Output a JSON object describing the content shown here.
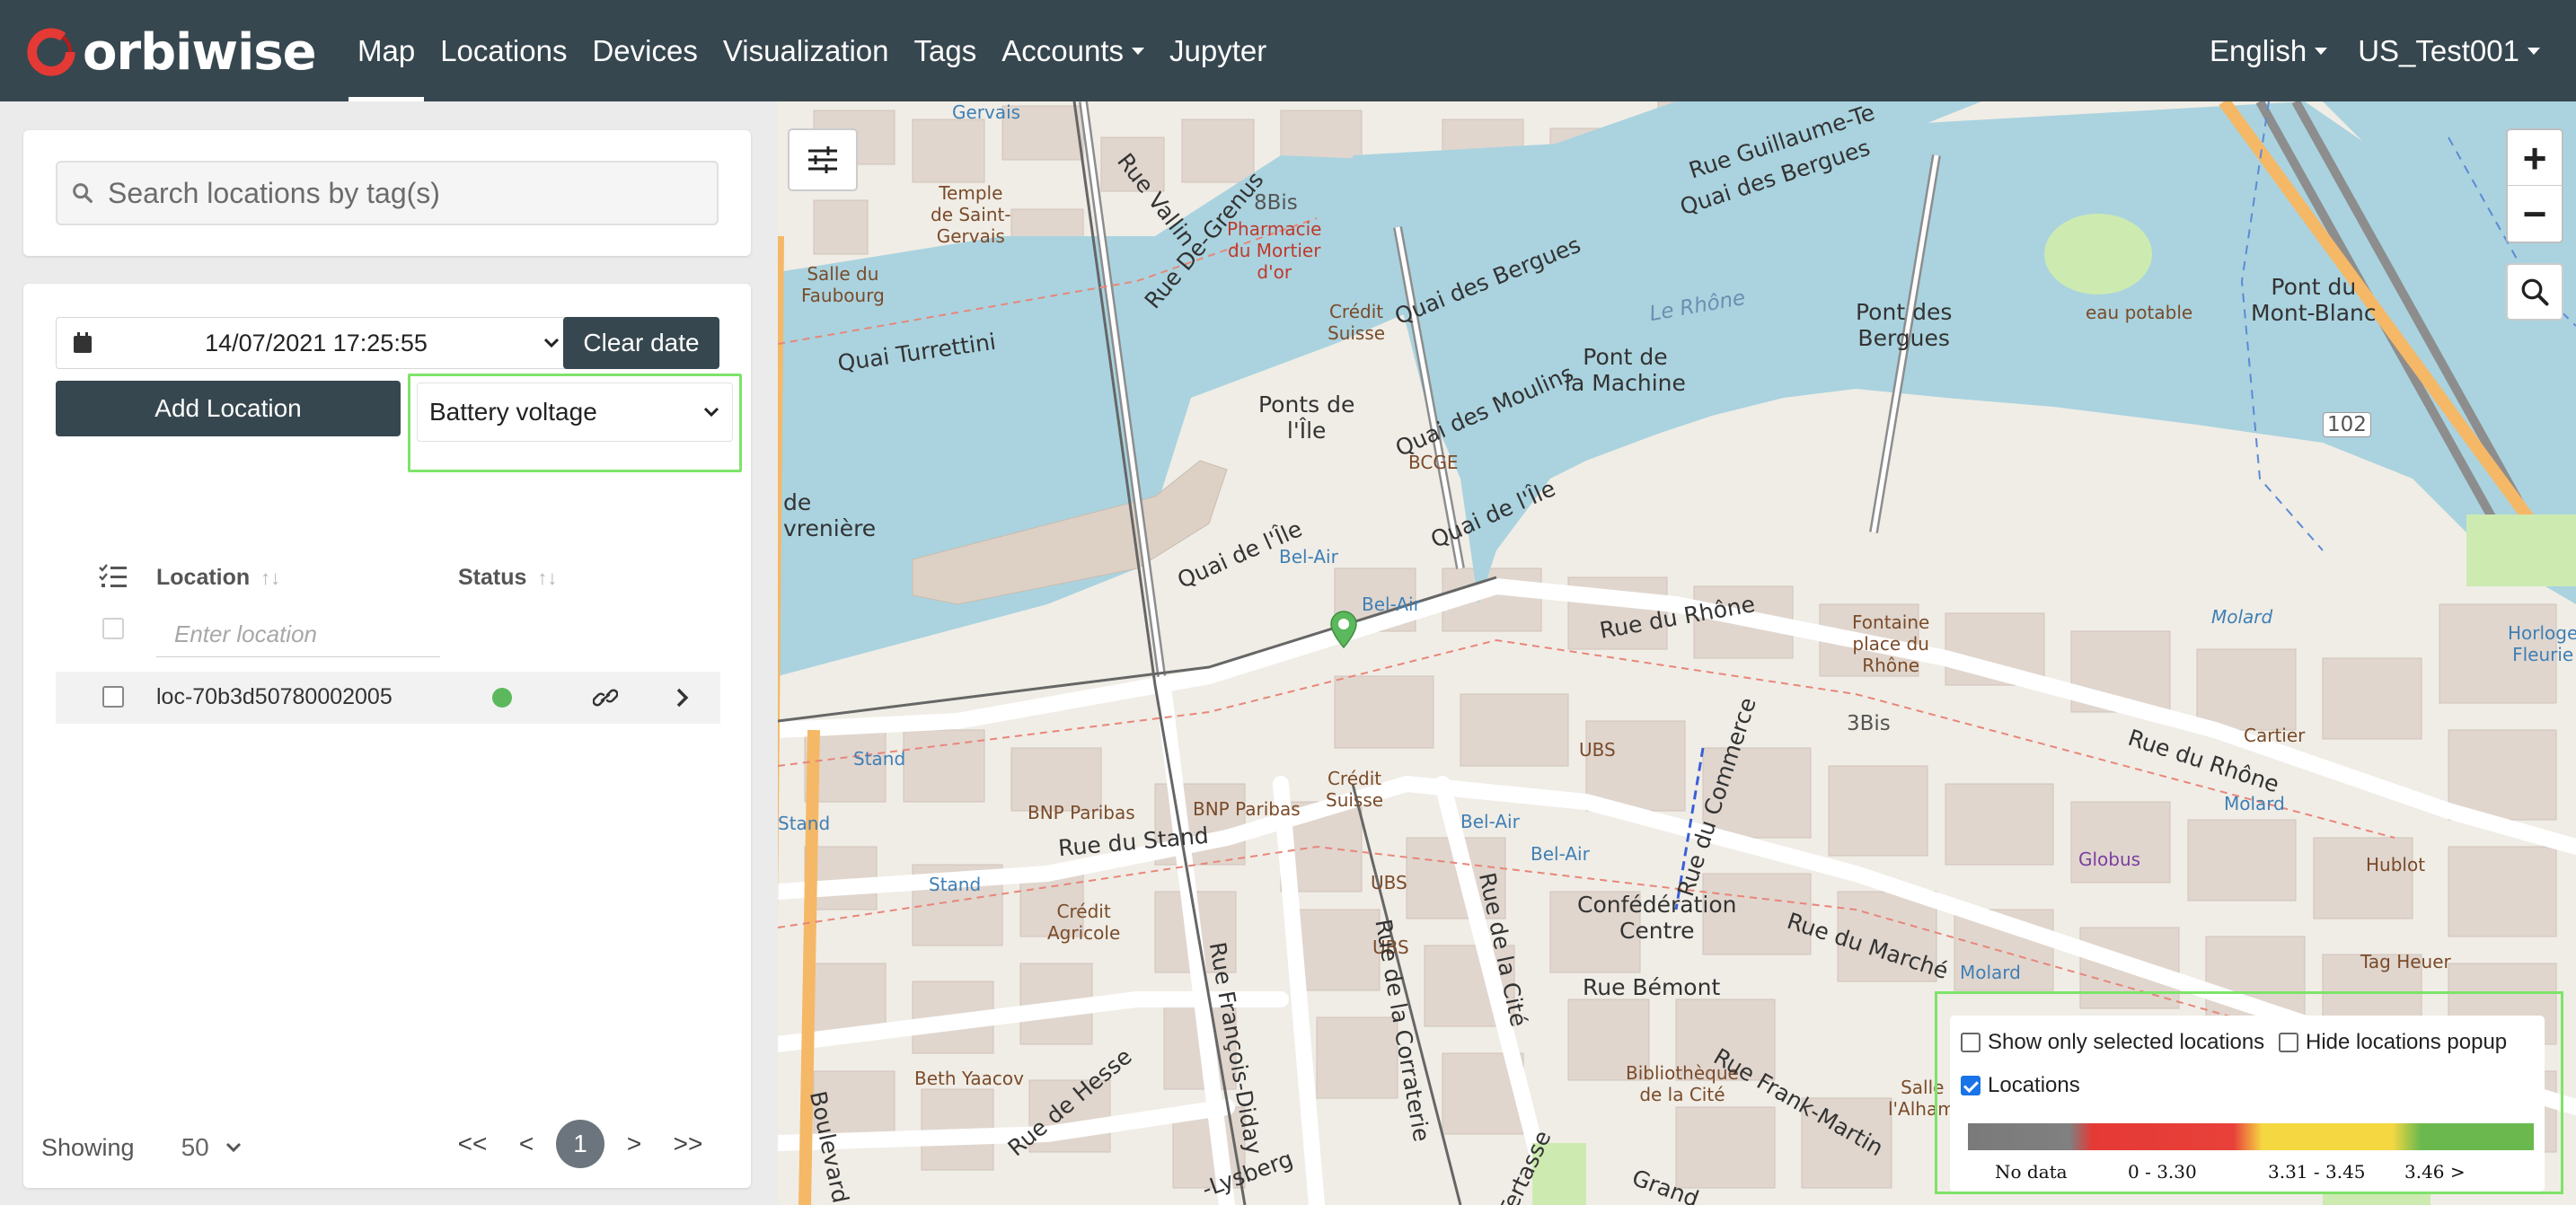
{
  "app": {
    "brand": "orbiwise"
  },
  "nav": {
    "items": [
      {
        "label": "Map",
        "active": true
      },
      {
        "label": "Locations"
      },
      {
        "label": "Devices"
      },
      {
        "label": "Visualization"
      },
      {
        "label": "Tags"
      },
      {
        "label": "Accounts"
      },
      {
        "label": "Jupyter"
      }
    ],
    "language": "English",
    "user": "US_Test001"
  },
  "sidebar": {
    "search": {
      "placeholder": "Search locations by tag(s)"
    },
    "date": {
      "value": "14/07/2021 17:25:55"
    },
    "clear_date_label": "Clear date",
    "add_location_label": "Add Location",
    "metric_select": {
      "value": "Battery voltage"
    },
    "table": {
      "columns": {
        "location": "Location",
        "status": "Status"
      },
      "filter_placeholder": "Enter location",
      "rows": [
        {
          "name": "loc-70b3d50780002005",
          "status": "ok"
        }
      ]
    },
    "footer": {
      "showing_label": "Showing",
      "page_size": "50",
      "pager": {
        "first": "<<",
        "prev": "<",
        "current": "1",
        "next": ">",
        "last": ">>"
      }
    }
  },
  "map": {
    "labels": {
      "rue_vallin": "Rue Vallin",
      "rue_de_grenus": "Rue De-Grenus",
      "temple": "Temple\nde Saint-\nGervais",
      "pharmacie": "Pharmacie\ndu Mortier\nd'or",
      "bis_8": "8Bis",
      "salle_faubourg": "Salle du\nFaubourg",
      "credit_suisse_1": "Crédit\nSuisse",
      "quai_bergues": "Quai des Bergues",
      "quai_bergues_2": "Quai des Bergues",
      "rue_guillaume": "Rue Guillaume-Te",
      "le_rhone": "Le Rhône",
      "pont_bergues": "Pont des\nBergues",
      "eau_potable": "eau potable",
      "pont_mont_blanc": "Pont du\nMont-Blanc",
      "pont_machine": "Pont de\nla Machine",
      "quai_turrettini": "Quai Turrettini",
      "ponts_ile": "Ponts de\nl'Île",
      "quai_moulins": "Quai des Moulins",
      "bcge": "BCGE",
      "quai_ile_1": "Quai de l'Île",
      "quai_ile_2": "Quai de l'Île",
      "riviere": "de\nvrenière",
      "bel_air_1": "Bel-Air",
      "bel_air_2": "Bel-Air",
      "rue_rhone_1": "Rue du Rhône",
      "rue_rhone_2": "Rue du Rhône",
      "fontaine": "Fontaine\nplace du\nRhône",
      "molard": "Molard",
      "horloge": "Horloge\nFleurie",
      "cartier": "Cartier",
      "molard_2": "Molard",
      "ubs_1": "UBS",
      "rue_commerce": "Rue du Commerce",
      "bis_3": "3Bis",
      "credit_suisse_2": "Crédit\nSuisse",
      "bnp_1": "BNP Paribas",
      "bnp_2": "BNP Paribas",
      "stand_1": "Stand",
      "stand_2": "Stand",
      "stand_3": "Stand",
      "rue_stand": "Rue du Stand",
      "credit_agricole": "Crédit\nAgricole",
      "bel_air_3": "Bel-Air",
      "bel_air_4": "Bel-Air",
      "ubs_2": "UBS",
      "ubs_3": "UBS",
      "globus": "Globus",
      "hublot": "Hublot",
      "tag_heuer": "Tag Heuer",
      "molard_3": "Molard",
      "confederation": "Confédération\nCentre",
      "rue_marche": "Rue du Marché",
      "rue_cite": "Rue de la Cité",
      "rue_corraterie": "Rue de la Corraterie",
      "rue_francois_diday": "Rue François-Diday",
      "rue_hesse": "Rue de Hesse",
      "rue_bemont": "Rue Bémont",
      "bibliotheque": "Bibliothèque\nde la Cité",
      "rue_frank_martin": "Rue Frank-Martin",
      "salle_alhambra": "Salle de\nl'Alhambra",
      "beth_yaacov": "Beth Yaacov",
      "boulevard": "Boulevard",
      "lysberg": "-Lysberg",
      "tertasse": "Tertasse",
      "grand": "Grand",
      "gervais": "Gervais",
      "road_102": "102"
    },
    "zoom_in": "+",
    "zoom_out": "−"
  },
  "legend": {
    "show_only_selected": {
      "label": "Show only selected locations",
      "checked": false
    },
    "hide_popup": {
      "label": "Hide locations popup",
      "checked": false
    },
    "locations": {
      "label": "Locations",
      "checked": true
    },
    "ranges": [
      {
        "label": "No data",
        "color": "#7a7a7a"
      },
      {
        "label": "0 - 3.30",
        "color": "#e53935"
      },
      {
        "label": "3.31 - 3.45",
        "color": "#f5d742"
      },
      {
        "label": "3.46 >",
        "color": "#6bb94e"
      }
    ]
  },
  "colors": {
    "navbar": "#37474f",
    "highlight": "#7ee36a",
    "water": "#aad3df",
    "status_ok": "#5cb85c"
  }
}
